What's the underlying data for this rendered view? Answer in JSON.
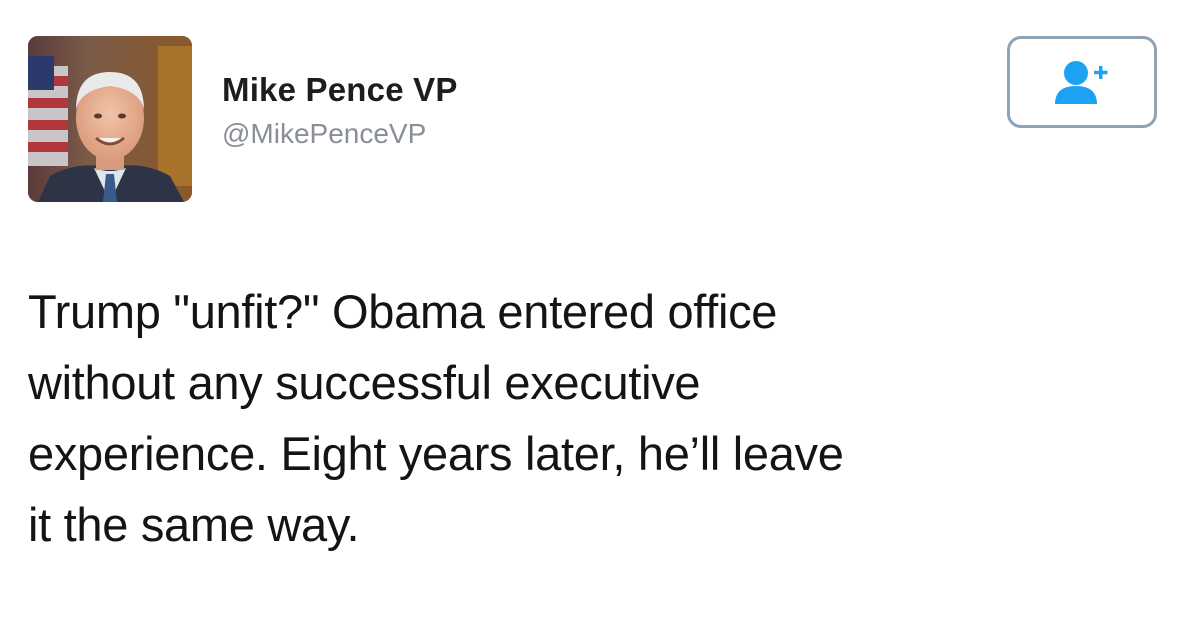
{
  "user": {
    "display_name": "Mike Pence VP",
    "handle": "@MikePenceVP",
    "avatar_icon": "profile-photo"
  },
  "follow_button": {
    "icon": "add-user-icon",
    "color": "#1da1f2"
  },
  "tweet": {
    "text_lines": [
      "Trump \"unfit?\" Obama entered office",
      "without any successful executive",
      "experience. Eight years later, he’ll leave",
      "it the same way."
    ]
  }
}
